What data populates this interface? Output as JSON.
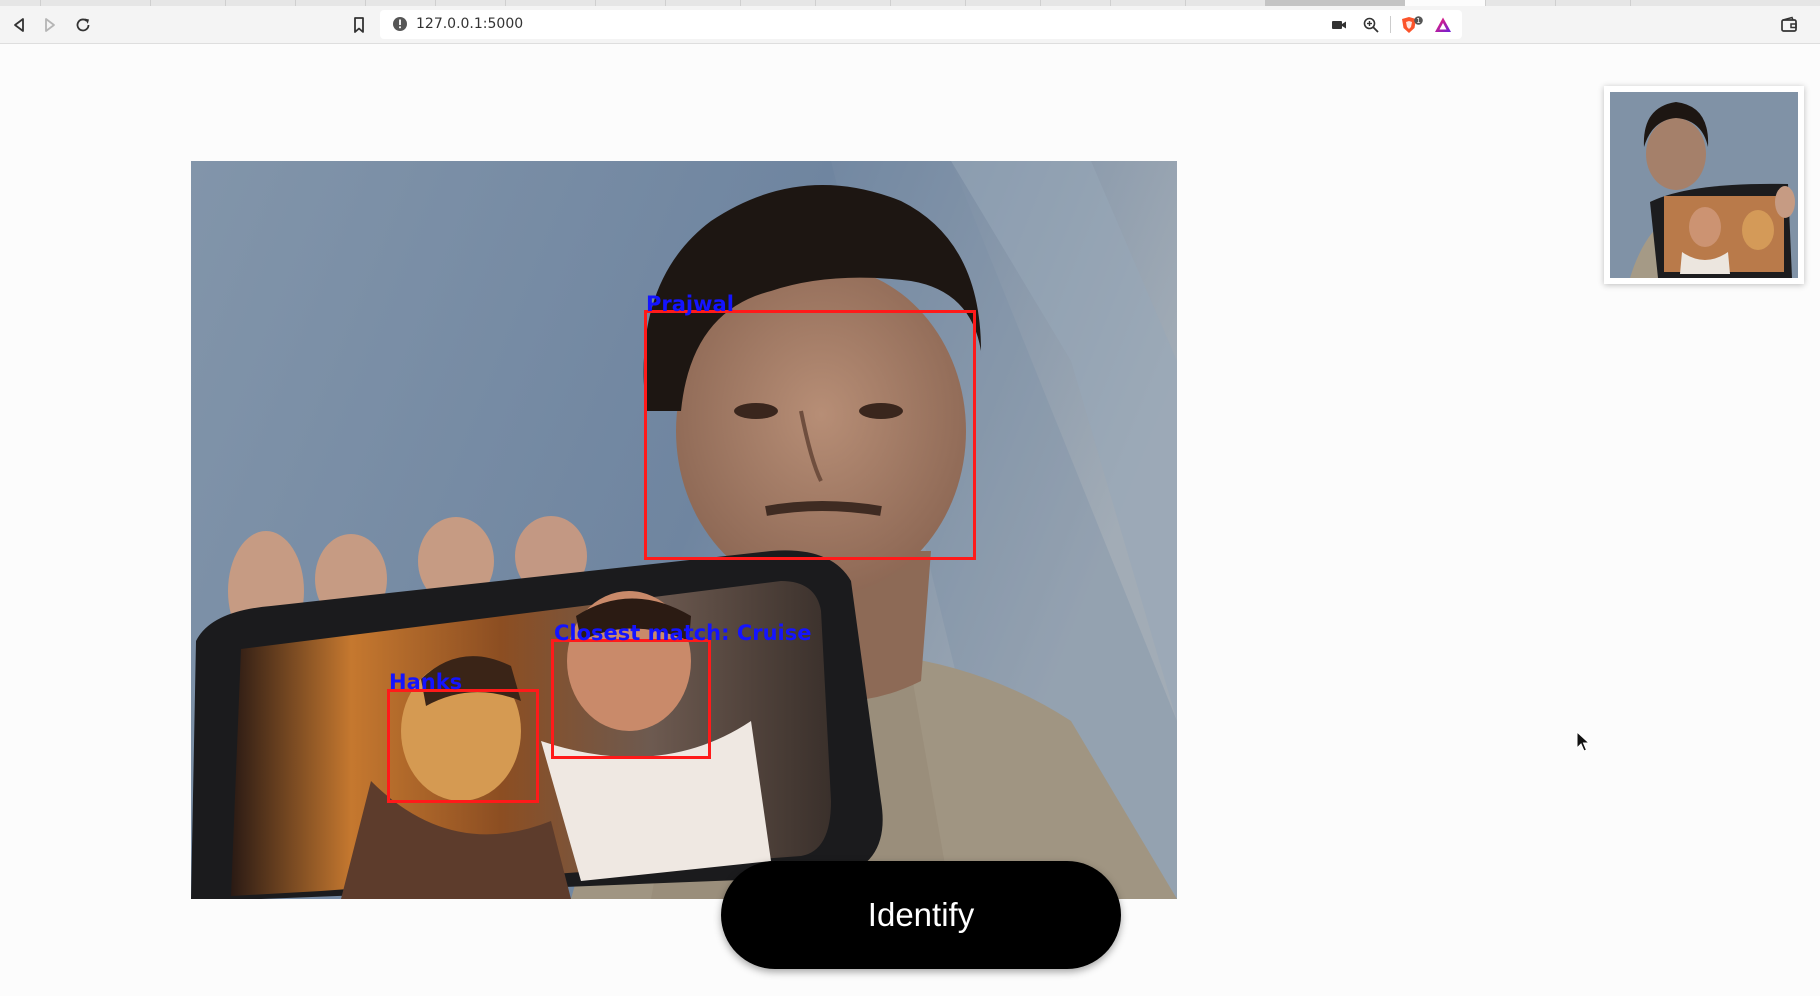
{
  "browser": {
    "url": "127.0.0.1:5000",
    "brave_badge_count": "1",
    "icons": {
      "back": "back-arrow-icon",
      "forward": "forward-arrow-icon",
      "reload": "reload-icon",
      "bookmark": "bookmark-icon",
      "site_info": "info-icon",
      "camera": "camera-icon",
      "zoom": "zoom-icon",
      "brave": "brave-shield-icon",
      "rewards": "brave-rewards-icon",
      "wallet": "wallet-icon"
    }
  },
  "video": {
    "faces": [
      {
        "label": "Prajwal"
      },
      {
        "label": "Closest match: Cruise"
      },
      {
        "label": "Hanks"
      }
    ],
    "colors": {
      "label": "#1414ff",
      "box": "#ff1a1a"
    }
  },
  "identify_button": {
    "label": "Identify"
  },
  "colors": {
    "button_bg": "#000000",
    "button_text": "#ffffff",
    "page_bg": "#fcfcfc"
  }
}
